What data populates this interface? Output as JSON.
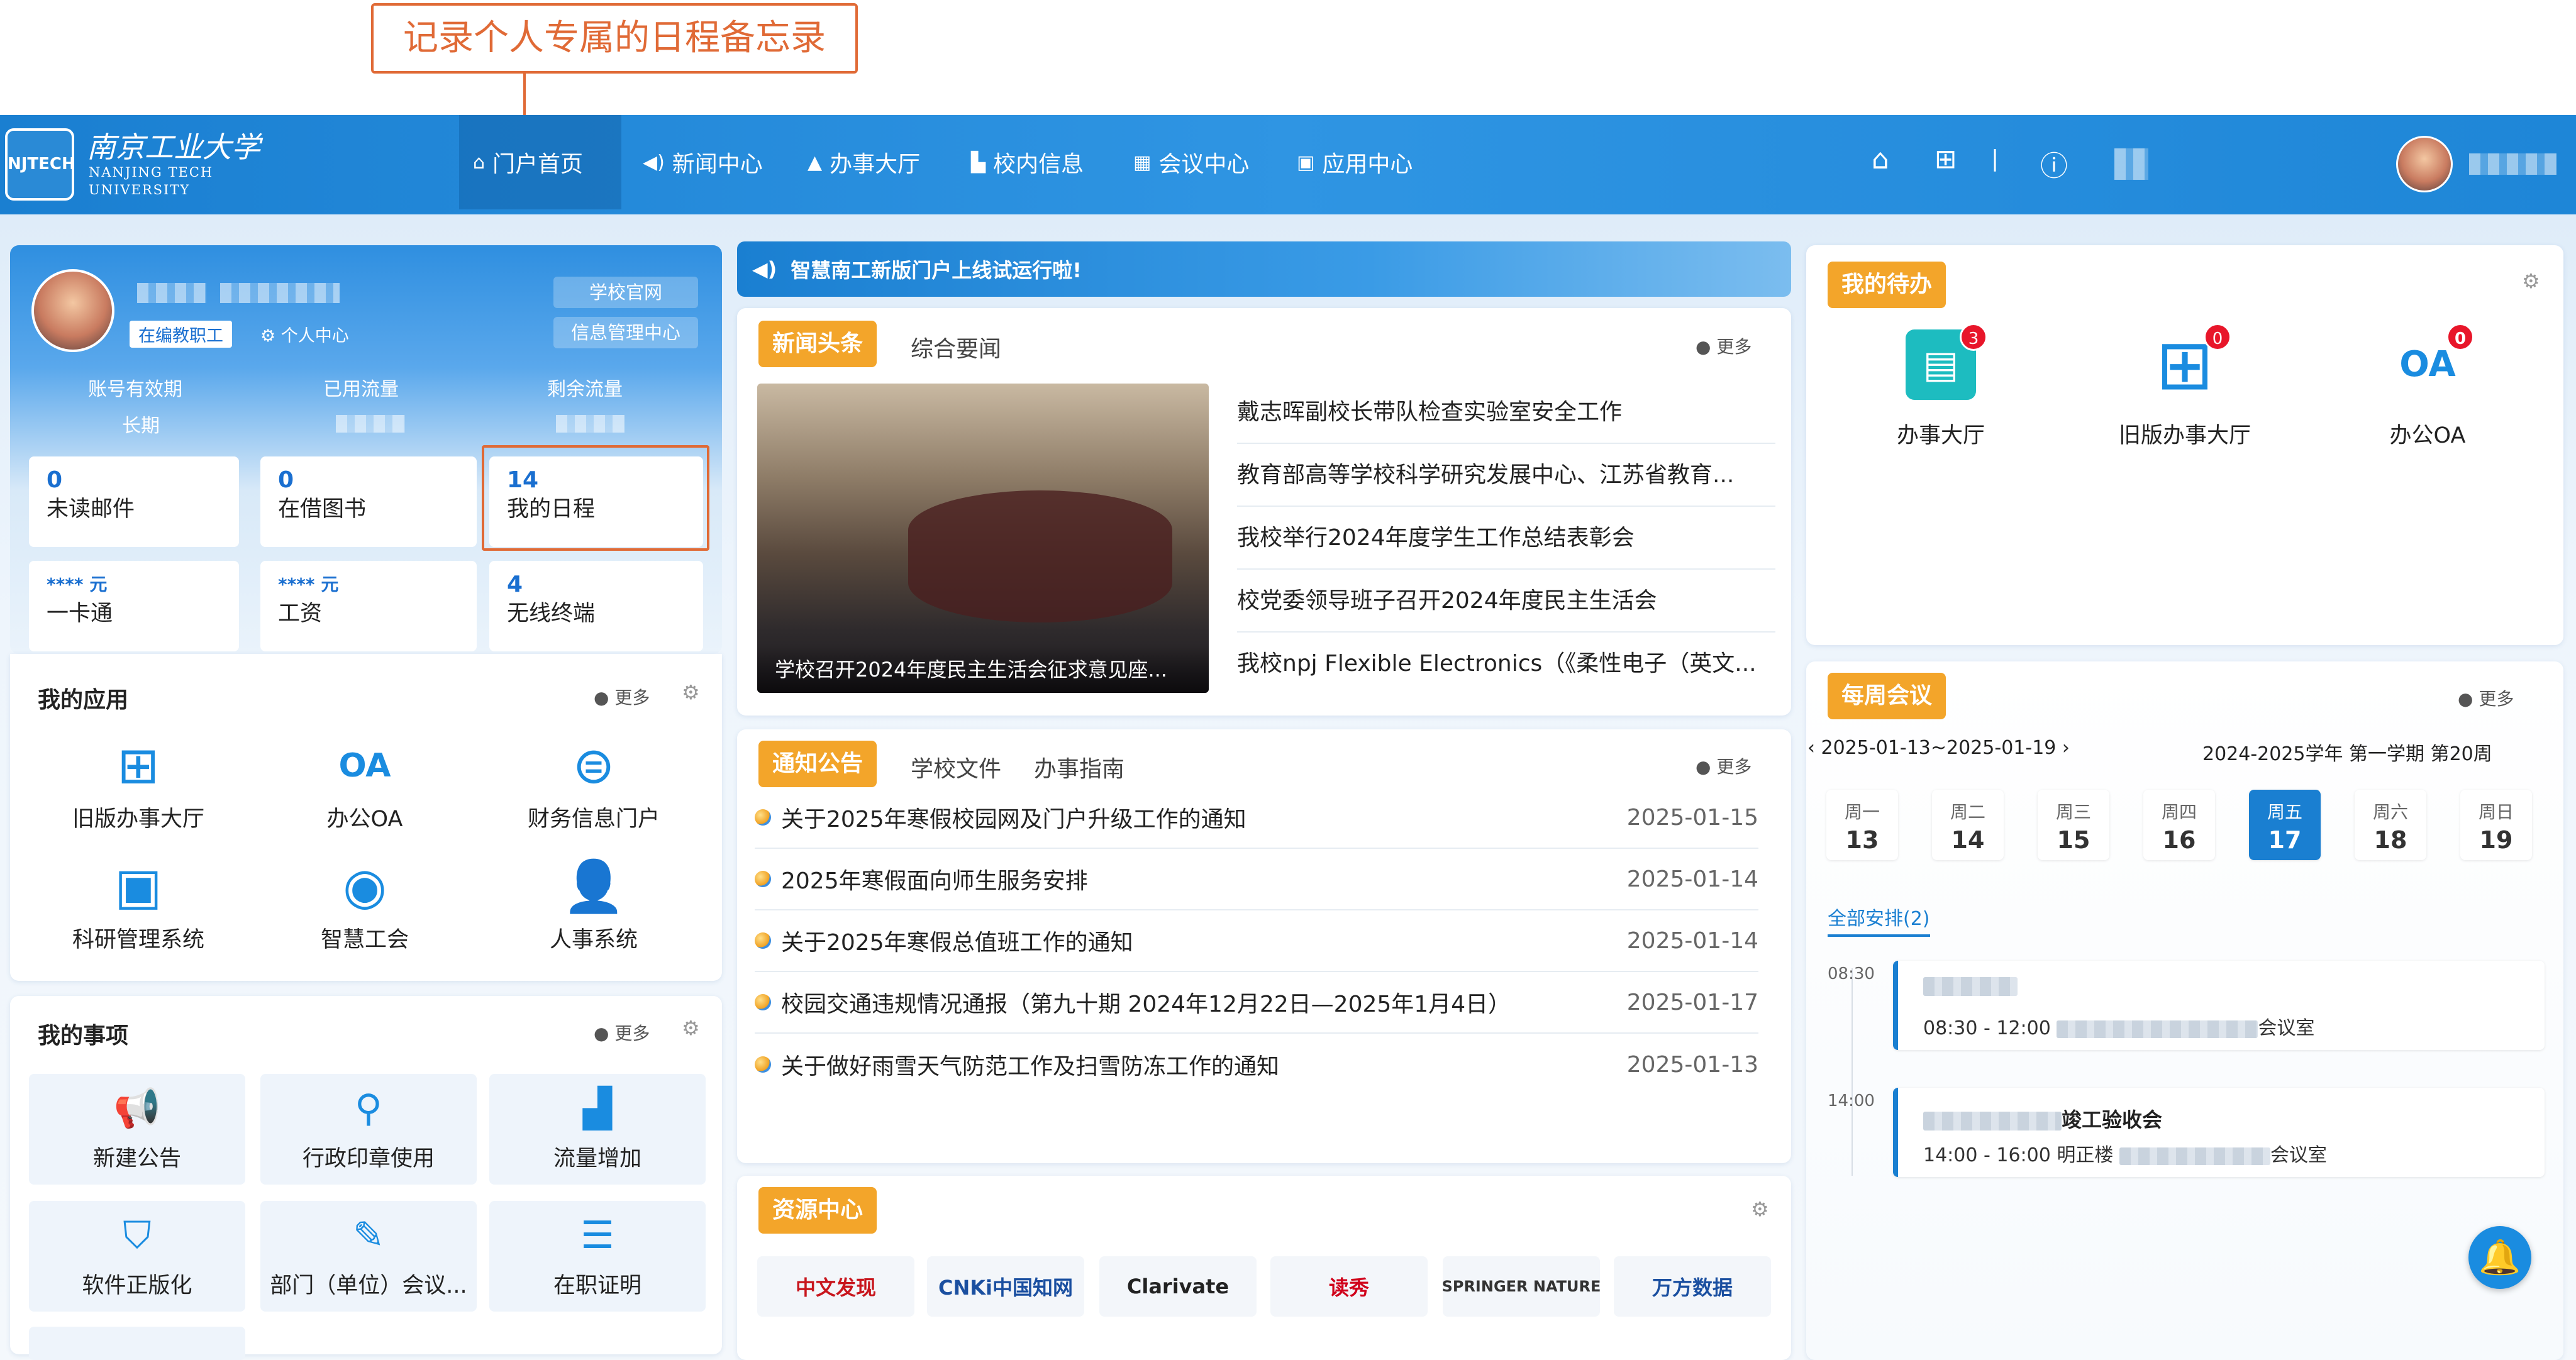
{
  "callout": {
    "text": "记录个人专属的日程备忘录"
  },
  "header": {
    "logo_cn": "南京工业大学",
    "logo_en_1": "NANJING TECH",
    "logo_en_2": "UNIVERSITY",
    "nav": [
      {
        "label": "门户首页",
        "icon": "home-icon",
        "active": true
      },
      {
        "label": "新闻中心",
        "icon": "speaker-icon"
      },
      {
        "label": "办事大厅",
        "icon": "building-icon"
      },
      {
        "label": "校内信息",
        "icon": "info-icon"
      },
      {
        "label": "会议中心",
        "icon": "calendar-icon"
      },
      {
        "label": "应用中心",
        "icon": "grid-icon"
      }
    ],
    "right_icons": [
      "home-icon",
      "apps-grid-icon",
      "help-icon"
    ],
    "separator": "|"
  },
  "profile": {
    "role_badge": "在编教职工",
    "personal_center": "个人中心",
    "school_site": "学校官网",
    "info_center": "信息管理中心",
    "stats_labels": [
      "账号有效期",
      "已用流量",
      "剩余流量"
    ],
    "account_validity": "长期"
  },
  "tiles": [
    {
      "num": "0",
      "label": "未读邮件"
    },
    {
      "num": "0",
      "label": "在借图书"
    },
    {
      "num": "14",
      "label": "我的日程"
    },
    {
      "num": "**** 元",
      "label": "一卡通"
    },
    {
      "num": "**** 元",
      "label": "工资"
    },
    {
      "num": "4",
      "label": "无线终端"
    }
  ],
  "my_apps": {
    "title": "我的应用",
    "more": "更多",
    "items": [
      {
        "label": "旧版办事大厅",
        "icon": "grid-apps-icon"
      },
      {
        "label": "办公OA",
        "icon": "oa-icon"
      },
      {
        "label": "财务信息门户",
        "icon": "finance-icon"
      },
      {
        "label": "科研管理系统",
        "icon": "monitor-gear-icon"
      },
      {
        "label": "智慧工会",
        "icon": "union-icon"
      },
      {
        "label": "人事系统",
        "icon": "hr-icon"
      }
    ]
  },
  "my_matters": {
    "title": "我的事项",
    "more": "更多",
    "items": [
      {
        "label": "新建公告",
        "icon": "megaphone-icon"
      },
      {
        "label": "行政印章使用",
        "icon": "stamp-icon"
      },
      {
        "label": "流量增加",
        "icon": "bar-chart-icon"
      },
      {
        "label": "软件正版化",
        "icon": "shield-icon"
      },
      {
        "label": "部门（单位）会议...",
        "icon": "meeting-icon"
      },
      {
        "label": "在职证明",
        "icon": "certificate-icon"
      }
    ]
  },
  "announcement_bar": "智慧南工新版门户上线试运行啦!",
  "news": {
    "tabs": [
      "新闻头条",
      "综合要闻"
    ],
    "more": "更多",
    "image_caption": "学校召开2024年度民主生活会征求意见座...",
    "items": [
      "戴志晖副校长带队检查实验室安全工作",
      "教育部高等学校科学研究发展中心、江苏省教育...",
      "我校举行2024年度学生工作总结表彰会",
      "校党委领导班子召开2024年度民主生活会",
      "我校npj Flexible Electronics（《柔性电子（英文..."
    ]
  },
  "notices": {
    "tabs": [
      "通知公告",
      "学校文件",
      "办事指南"
    ],
    "more": "更多",
    "items": [
      {
        "title": "关于2025年寒假校园网及门户升级工作的通知",
        "date": "2025-01-15"
      },
      {
        "title": "2025年寒假面向师生服务安排",
        "date": "2025-01-14"
      },
      {
        "title": "关于2025年寒假总值班工作的通知",
        "date": "2025-01-14"
      },
      {
        "title": "校园交通违规情况通报（第九十期 2024年12月22日—2025年1月4日）",
        "date": "2025-01-17"
      },
      {
        "title": "关于做好雨雪天气防范工作及扫雪防冻工作的通知",
        "date": "2025-01-13"
      }
    ]
  },
  "resources": {
    "title": "资源中心",
    "items": [
      {
        "label": "中文发现",
        "color": "#c8161d"
      },
      {
        "label": "CNKi中国知网",
        "color": "#1a4fa0"
      },
      {
        "label": "Clarivate",
        "color": "#222222"
      },
      {
        "label": "读秀",
        "color": "#d0021b"
      },
      {
        "label": "SPRINGER NATURE",
        "color": "#333333"
      },
      {
        "label": "万方数据",
        "color": "#1a4fa0"
      }
    ]
  },
  "todo": {
    "title": "我的待办",
    "items": [
      {
        "label": "办事大厅",
        "badge": "3",
        "icon": "document-icon",
        "color": "#1dbcc0"
      },
      {
        "label": "旧版办事大厅",
        "badge": "0",
        "icon": "grid-apps-icon",
        "color": "#ffffff"
      },
      {
        "label": "办公OA",
        "badge": "0",
        "icon": "oa-icon",
        "color": "#ffffff"
      }
    ]
  },
  "meetings": {
    "title": "每周会议",
    "more": "更多",
    "range": "2025-01-13~2025-01-19",
    "term": "2024-2025学年 第一学期 第20周",
    "days": [
      {
        "w": "周一",
        "n": "13"
      },
      {
        "w": "周二",
        "n": "14"
      },
      {
        "w": "周三",
        "n": "15"
      },
      {
        "w": "周四",
        "n": "16"
      },
      {
        "w": "周五",
        "n": "17",
        "selected": true
      },
      {
        "w": "周六",
        "n": "18"
      },
      {
        "w": "周日",
        "n": "19"
      }
    ],
    "filter": "全部安排(2)",
    "events": [
      {
        "time": "08:30",
        "title": "",
        "detail_time": "08:30 - 12:00",
        "place_suffix": "会议室"
      },
      {
        "time": "14:00",
        "title": "竣工验收会",
        "detail_time": "14:00 - 16:00",
        "building": "明正楼",
        "place_suffix": "会议室"
      }
    ]
  },
  "colors": {
    "accent": "#1a7fd1",
    "orange": "#f3a52a",
    "callout": "#e06a36",
    "badge": "#e8162a"
  }
}
